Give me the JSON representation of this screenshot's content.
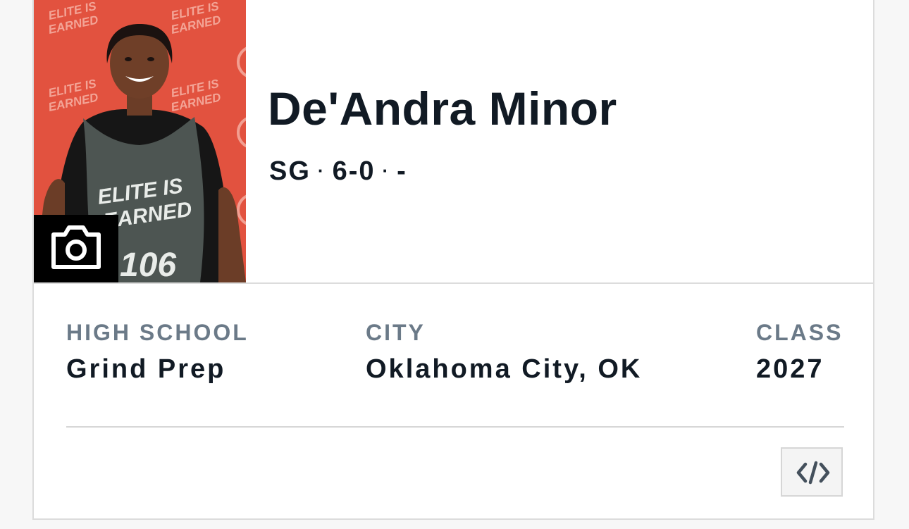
{
  "profile": {
    "name": "De'Andra Minor",
    "position": "SG",
    "height": "6-0",
    "extra": "-",
    "separator": "·"
  },
  "details": {
    "high_school": {
      "label": "HIGH SCHOOL",
      "value": "Grind Prep"
    },
    "city": {
      "label": "CITY",
      "value": "Oklahoma City, OK"
    },
    "class": {
      "label": "CLASS",
      "value": "2027"
    }
  },
  "photo": {
    "background_color": "#e2523f",
    "jersey_number": "106",
    "jersey_lettering": "ELITE IS EARNED",
    "banner_text": "ELITE IS EARNED"
  },
  "icons": {
    "camera": "camera-icon",
    "embed": "code-embed-icon"
  },
  "colors": {
    "text_dark": "#111a24",
    "label_gray": "#6b7a88",
    "border": "#dcdcdc"
  }
}
